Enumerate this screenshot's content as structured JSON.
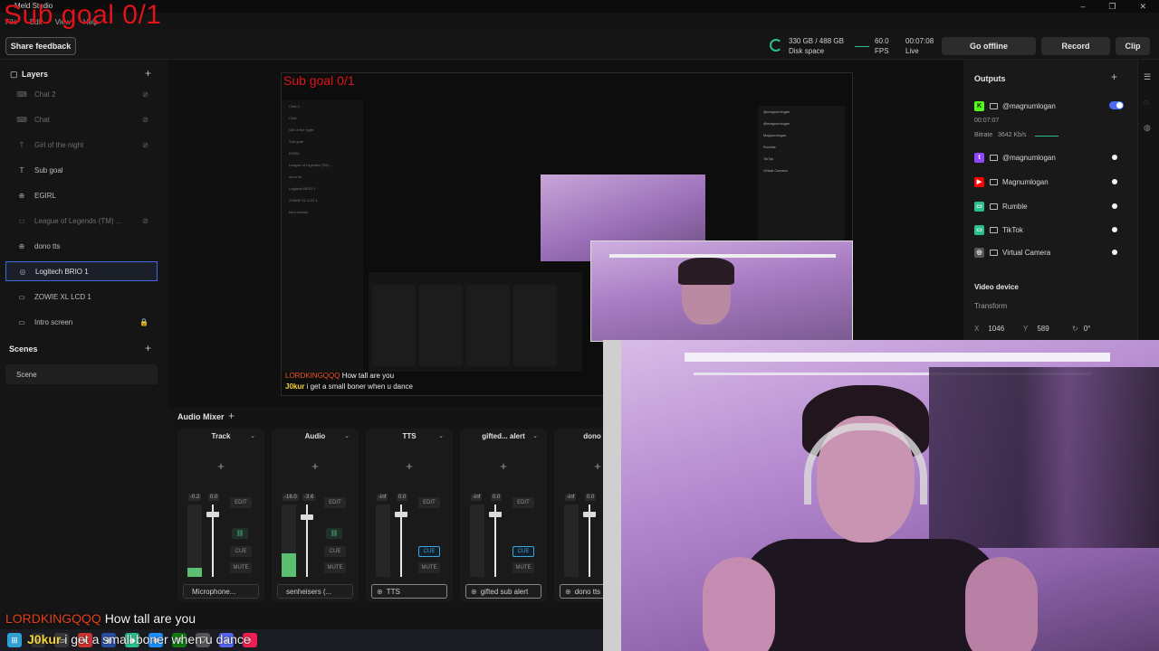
{
  "window": {
    "app_title": "Meld Studio",
    "menu": [
      "File",
      "Edit",
      "View",
      "Help"
    ],
    "controls": [
      "–",
      "❐",
      "✕"
    ]
  },
  "overlay": {
    "sub_goal": "Sub goal 0/1"
  },
  "toolbar": {
    "share_feedback": "Share feedback",
    "disk_value": "330 GB / 488 GB",
    "disk_label": "Disk space",
    "fps_value": "60.0",
    "fps_label": "FPS",
    "time_value": "00:07:08",
    "time_label": "Live",
    "go_offline": "Go offline",
    "record": "Record",
    "clip": "Clip"
  },
  "layers": {
    "title": "Layers",
    "items": [
      {
        "label": "Chat 2",
        "icon": "⌨",
        "hidden": true
      },
      {
        "label": "Chat",
        "icon": "⌨",
        "hidden": true
      },
      {
        "label": "Girl of the night",
        "icon": "T",
        "hidden": true
      },
      {
        "label": "Sub goal",
        "icon": "T",
        "hidden": false
      },
      {
        "label": "EGIRL",
        "icon": "⊕",
        "hidden": false
      },
      {
        "label": "League of Legends (TM) ...",
        "icon": "▭",
        "hidden": true
      },
      {
        "label": "dono tts",
        "icon": "⊕",
        "hidden": false
      },
      {
        "label": "Logitech BRIO 1",
        "icon": "◎",
        "hidden": false,
        "selected": true
      },
      {
        "label": "ZOWIE XL LCD 1",
        "icon": "▭",
        "hidden": false
      },
      {
        "label": "Intro screen",
        "icon": "▭",
        "hidden": false,
        "locked": true
      }
    ]
  },
  "scenes": {
    "title": "Scenes",
    "items": [
      "Scene"
    ]
  },
  "mixer": {
    "title": "Audio Mixer",
    "channels": [
      {
        "name": "Track",
        "db_left": "-0.2",
        "db_right": "0.0",
        "level": 0.12,
        "fader": 0.9,
        "source": "Microphone...",
        "cue_on": false,
        "linked": true
      },
      {
        "name": "Audio",
        "db_left": "-16.0",
        "db_right": "-3.6",
        "level": 0.32,
        "fader": 0.86,
        "source": "senheisers (...",
        "cue_on": false,
        "linked": true
      },
      {
        "name": "TTS",
        "db_left": "-inf",
        "db_right": "0.0",
        "level": 0,
        "fader": 0.9,
        "source": "TTS",
        "cue_on": true,
        "linked": false
      },
      {
        "name": "gifted... alert",
        "db_left": "-inf",
        "db_right": "0.0",
        "level": 0,
        "fader": 0.9,
        "source": "gifted sub alert",
        "cue_on": true,
        "linked": false
      },
      {
        "name": "dono tts",
        "db_left": "-inf",
        "db_right": "0.0",
        "level": 0,
        "fader": 0.9,
        "source": "dono tts",
        "cue_on": false,
        "linked": false
      }
    ],
    "edit": "EDIT",
    "cue": "CUE",
    "mute": "MUTE"
  },
  "outputs": {
    "title": "Outputs",
    "primary": {
      "name": "@magnumlogan",
      "timer": "00:07:07",
      "bitrate_label": "Bitrate",
      "bitrate_value": "3642 Kb/s"
    },
    "items": [
      {
        "name": "@magnumlogan",
        "color": "#9146ff",
        "glyph": "t"
      },
      {
        "name": "Magnumlogan",
        "color": "#ff0000",
        "glyph": "▶"
      },
      {
        "name": "Rumble",
        "color": "#2bc08b",
        "glyph": "▭"
      },
      {
        "name": "TikTok",
        "color": "#2bc08b",
        "glyph": "▭"
      },
      {
        "name": "Virtual Camera",
        "color": "#555555",
        "glyph": "◎"
      }
    ],
    "kick_color": "#53fc18"
  },
  "video_device": {
    "title": "Video device",
    "transform_label": "Transform",
    "x_label": "X",
    "x_value": "1046",
    "y_label": "Y",
    "y_value": "589",
    "rotation": "0°"
  },
  "chat": [
    {
      "user": "LORDKINGQQQ",
      "text": "How tall are you"
    },
    {
      "user": "J0kur",
      "text": "i get a small boner when u dance"
    }
  ]
}
